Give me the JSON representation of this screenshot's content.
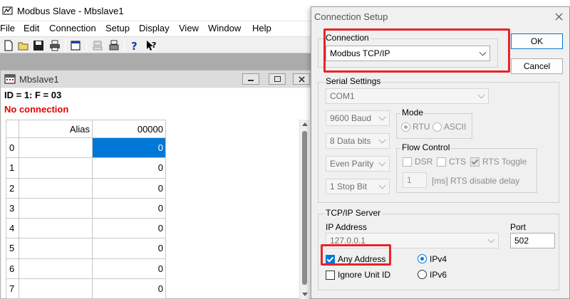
{
  "app": {
    "title": "Modbus Slave - Mbslave1",
    "menu": [
      "File",
      "Edit",
      "Connection",
      "Setup",
      "Display",
      "View",
      "Window",
      "Help"
    ]
  },
  "child_window": {
    "title": "Mbslave1",
    "id_line": "ID = 1: F = 03",
    "status": "No connection",
    "status_color": "#e00000",
    "grid": {
      "headers": [
        "Alias",
        "00000"
      ],
      "rows": [
        {
          "index": "0",
          "value": "0"
        },
        {
          "index": "1",
          "value": "0"
        },
        {
          "index": "2",
          "value": "0"
        },
        {
          "index": "3",
          "value": "0"
        },
        {
          "index": "4",
          "value": "0"
        },
        {
          "index": "5",
          "value": "0"
        },
        {
          "index": "6",
          "value": "0"
        },
        {
          "index": "7",
          "value": "0"
        }
      ]
    }
  },
  "dialog": {
    "title": "Connection Setup",
    "ok_label": "OK",
    "cancel_label": "Cancel",
    "connection": {
      "label": "Connection",
      "value": "Modbus TCP/IP"
    },
    "serial": {
      "label": "Serial Settings",
      "port": "COM1",
      "baud": "9600 Baud",
      "data_bits": "8 Data bits",
      "parity": "Even Parity",
      "stop_bits": "1 Stop Bit",
      "mode_label": "Mode",
      "mode_rtu": "RTU",
      "mode_ascii": "ASCII",
      "flow_label": "Flow Control",
      "dsr": "DSR",
      "cts": "CTS",
      "rts_toggle": "RTS Toggle",
      "rts_delay_value": "1",
      "rts_delay_label": "[ms] RTS disable delay"
    },
    "tcp": {
      "label": "TCP/IP Server",
      "ip_label": "IP Address",
      "ip_value": "127.0.0.1",
      "port_label": "Port",
      "port_value": "502",
      "any_address": "Any Address",
      "ignore_unit_id": "Ignore Unit ID",
      "ipv4": "IPv4",
      "ipv6": "IPv6"
    }
  },
  "highlight_color": "#e8232a"
}
